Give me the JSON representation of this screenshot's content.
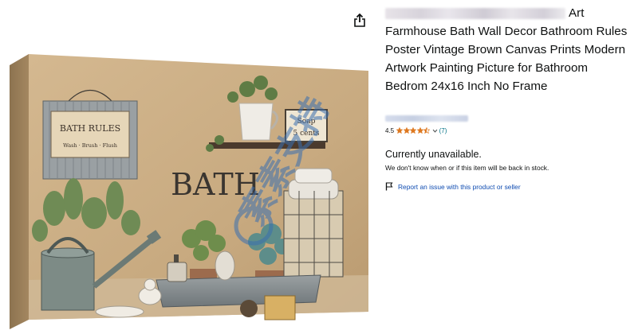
{
  "product": {
    "title": "Art Farmhouse Bath Wall Decor Bathroom Rules Poster Vintage Brown Canvas Prints Modern Artwork Painting Picture for Bathroom Bedrom 24x16 Inch No Frame",
    "rating": "4.5",
    "rating_stars": 4.5,
    "review_count": "(7)",
    "availability": "Currently unavailable.",
    "availability_note": "We don't know when or if this item will be back in stock.",
    "report_label": "Report an issue with this product or seller"
  },
  "artwork": {
    "sign_title": "BATH RULES",
    "sign_subtitle": "Wash · Brush · Flush",
    "heading": "BATH",
    "tag_line1": "Soap",
    "tag_line2": "5 cents"
  },
  "watermark": {
    "text": "素素支持"
  },
  "icons": {
    "share": "share-icon",
    "flag": "flag-icon",
    "chevron": "chevron-down-icon",
    "star": "star-icon"
  },
  "colors": {
    "text": "#0f1111",
    "link": "#007185",
    "report_link": "#0f4cb1",
    "star": "#de7921",
    "canvas_bg": "#c9ac83",
    "watermark": "#3a6fb0"
  }
}
